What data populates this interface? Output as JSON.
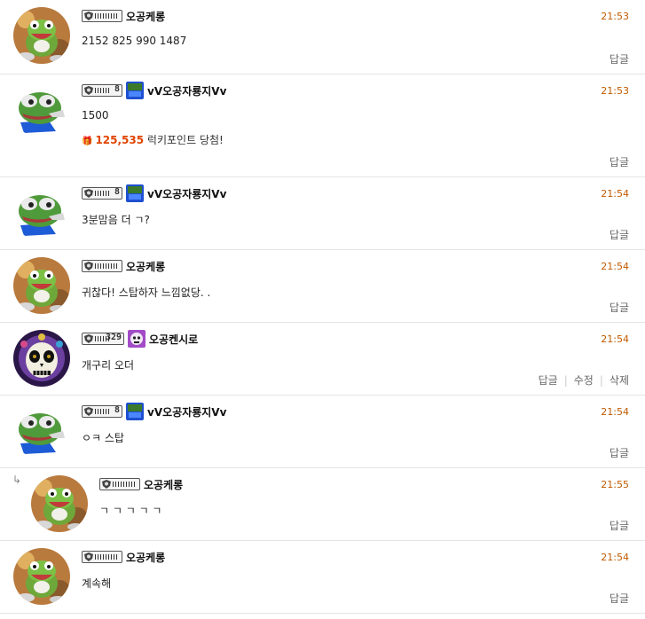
{
  "comments": [
    {
      "nick": "오공케롱",
      "time": "21:53",
      "text": "2152   825   990   1487",
      "level": "",
      "avatar": "frog",
      "badge": "",
      "actions": [
        "답글"
      ]
    },
    {
      "nick": "vV오공자룡지Vv",
      "time": "21:53",
      "text": "1500",
      "level": "8",
      "avatar": "pepe",
      "badge": "blue",
      "actions": [
        "답글"
      ],
      "lucky": {
        "points": "125,535",
        "suffix": " 럭키포인트 당첨!"
      }
    },
    {
      "nick": "vV오공자룡지Vv",
      "time": "21:54",
      "text": "3분맘음 더 ㄱ?",
      "level": "8",
      "avatar": "pepe",
      "badge": "blue",
      "actions": [
        "답글"
      ]
    },
    {
      "nick": "오공케롱",
      "time": "21:54",
      "text": "귀찮다!  스탑하자 느낌없당. .",
      "level": "",
      "avatar": "frog",
      "badge": "",
      "actions": [
        "답글"
      ]
    },
    {
      "nick": "오공켄시로",
      "time": "21:54",
      "text": "개구리 오더",
      "level": "329",
      "avatar": "skull",
      "badge": "purple",
      "actions": [
        "답글",
        "수정",
        "삭제"
      ]
    },
    {
      "nick": "vV오공자룡지Vv",
      "time": "21:54",
      "text": "ㅇㅋ 스탑",
      "level": "8",
      "avatar": "pepe",
      "badge": "blue",
      "actions": [
        "답글"
      ]
    },
    {
      "nick": "오공케롱",
      "time": "21:55",
      "text": "ㄱ ㄱ ㄱ ㄱ ㄱ",
      "level": "",
      "avatar": "frog",
      "badge": "",
      "actions": [
        "답글"
      ],
      "reply": true
    },
    {
      "nick": "오공케롱",
      "time": "21:54",
      "text": "계속해",
      "level": "",
      "avatar": "frog",
      "badge": "",
      "actions": [
        "답글"
      ]
    }
  ],
  "colors": {
    "time": "#c05a00",
    "points": "#e04400",
    "badge_blue": "#1f4fd1",
    "badge_purple": "#a24bc6"
  },
  "icons": {
    "reply_arrow": "reply-arrow-icon",
    "gift": "gift-icon",
    "level": "level-shield-icon"
  }
}
